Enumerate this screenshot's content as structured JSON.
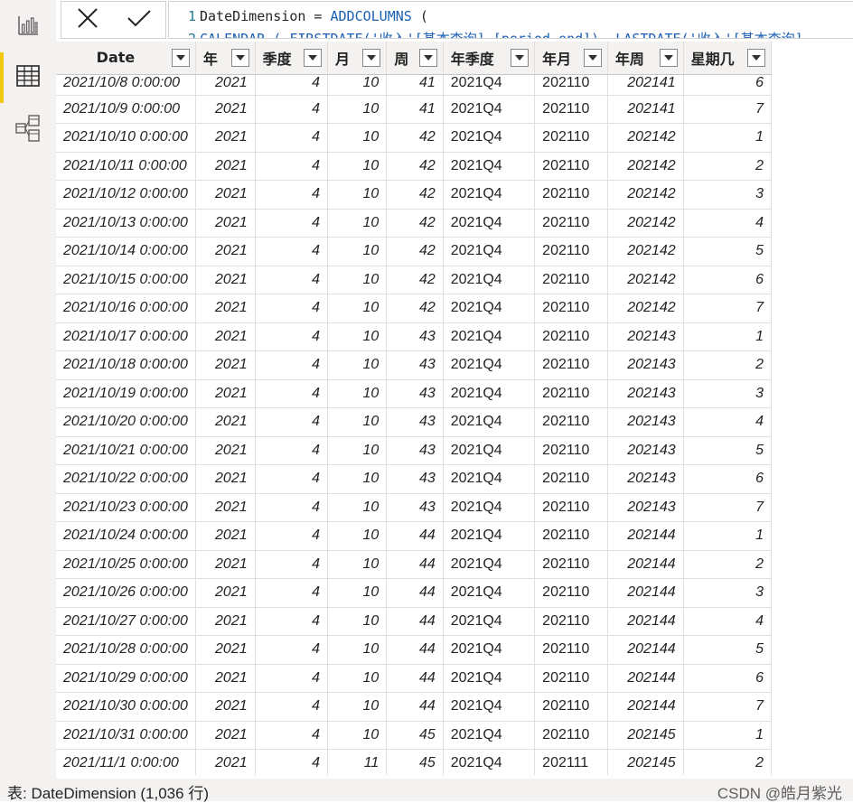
{
  "rail": {
    "items": [
      {
        "icon": "report-view-icon"
      },
      {
        "icon": "data-view-icon",
        "active": true
      },
      {
        "icon": "model-view-icon"
      }
    ]
  },
  "formula": {
    "line1_num": "1",
    "line1_name": "DateDimension = ",
    "line1_fn": "ADDCOLUMNS",
    "line1_paren": " (",
    "line2_num": "2",
    "line2_text": "CALENDAR ( FIRSTDATE('收入'[基本查询].[period_end]), LASTDATE('收入'[基本查询]"
  },
  "table": {
    "columns": [
      {
        "label": "Date",
        "align": "l"
      },
      {
        "label": "年",
        "align": "r"
      },
      {
        "label": "季度",
        "align": "r"
      },
      {
        "label": "月",
        "align": "r"
      },
      {
        "label": "周",
        "align": "r"
      },
      {
        "label": "年季度",
        "align": "l"
      },
      {
        "label": "年月",
        "align": "l"
      },
      {
        "label": "年周",
        "align": "r"
      },
      {
        "label": "星期几",
        "align": "r"
      }
    ],
    "rows": [
      [
        "2021/10/8 0:00:00",
        "2021",
        "4",
        "10",
        "41",
        "2021Q4",
        "202110",
        "202141",
        "6"
      ],
      [
        "2021/10/9 0:00:00",
        "2021",
        "4",
        "10",
        "41",
        "2021Q4",
        "202110",
        "202141",
        "7"
      ],
      [
        "2021/10/10 0:00:00",
        "2021",
        "4",
        "10",
        "42",
        "2021Q4",
        "202110",
        "202142",
        "1"
      ],
      [
        "2021/10/11 0:00:00",
        "2021",
        "4",
        "10",
        "42",
        "2021Q4",
        "202110",
        "202142",
        "2"
      ],
      [
        "2021/10/12 0:00:00",
        "2021",
        "4",
        "10",
        "42",
        "2021Q4",
        "202110",
        "202142",
        "3"
      ],
      [
        "2021/10/13 0:00:00",
        "2021",
        "4",
        "10",
        "42",
        "2021Q4",
        "202110",
        "202142",
        "4"
      ],
      [
        "2021/10/14 0:00:00",
        "2021",
        "4",
        "10",
        "42",
        "2021Q4",
        "202110",
        "202142",
        "5"
      ],
      [
        "2021/10/15 0:00:00",
        "2021",
        "4",
        "10",
        "42",
        "2021Q4",
        "202110",
        "202142",
        "6"
      ],
      [
        "2021/10/16 0:00:00",
        "2021",
        "4",
        "10",
        "42",
        "2021Q4",
        "202110",
        "202142",
        "7"
      ],
      [
        "2021/10/17 0:00:00",
        "2021",
        "4",
        "10",
        "43",
        "2021Q4",
        "202110",
        "202143",
        "1"
      ],
      [
        "2021/10/18 0:00:00",
        "2021",
        "4",
        "10",
        "43",
        "2021Q4",
        "202110",
        "202143",
        "2"
      ],
      [
        "2021/10/19 0:00:00",
        "2021",
        "4",
        "10",
        "43",
        "2021Q4",
        "202110",
        "202143",
        "3"
      ],
      [
        "2021/10/20 0:00:00",
        "2021",
        "4",
        "10",
        "43",
        "2021Q4",
        "202110",
        "202143",
        "4"
      ],
      [
        "2021/10/21 0:00:00",
        "2021",
        "4",
        "10",
        "43",
        "2021Q4",
        "202110",
        "202143",
        "5"
      ],
      [
        "2021/10/22 0:00:00",
        "2021",
        "4",
        "10",
        "43",
        "2021Q4",
        "202110",
        "202143",
        "6"
      ],
      [
        "2021/10/23 0:00:00",
        "2021",
        "4",
        "10",
        "43",
        "2021Q4",
        "202110",
        "202143",
        "7"
      ],
      [
        "2021/10/24 0:00:00",
        "2021",
        "4",
        "10",
        "44",
        "2021Q4",
        "202110",
        "202144",
        "1"
      ],
      [
        "2021/10/25 0:00:00",
        "2021",
        "4",
        "10",
        "44",
        "2021Q4",
        "202110",
        "202144",
        "2"
      ],
      [
        "2021/10/26 0:00:00",
        "2021",
        "4",
        "10",
        "44",
        "2021Q4",
        "202110",
        "202144",
        "3"
      ],
      [
        "2021/10/27 0:00:00",
        "2021",
        "4",
        "10",
        "44",
        "2021Q4",
        "202110",
        "202144",
        "4"
      ],
      [
        "2021/10/28 0:00:00",
        "2021",
        "4",
        "10",
        "44",
        "2021Q4",
        "202110",
        "202144",
        "5"
      ],
      [
        "2021/10/29 0:00:00",
        "2021",
        "4",
        "10",
        "44",
        "2021Q4",
        "202110",
        "202144",
        "6"
      ],
      [
        "2021/10/30 0:00:00",
        "2021",
        "4",
        "10",
        "44",
        "2021Q4",
        "202110",
        "202144",
        "7"
      ],
      [
        "2021/10/31 0:00:00",
        "2021",
        "4",
        "10",
        "45",
        "2021Q4",
        "202110",
        "202145",
        "1"
      ],
      [
        "2021/11/1 0:00:00",
        "2021",
        "4",
        "11",
        "45",
        "2021Q4",
        "202111",
        "202145",
        "2"
      ]
    ]
  },
  "status": {
    "table_info": "表: DateDimension (1,036 行)",
    "watermark": "CSDN @皓月紫光"
  },
  "colors": {
    "accent": "#f2c811",
    "function_keyword": "#1a5fb4",
    "line_number": "#237893"
  }
}
